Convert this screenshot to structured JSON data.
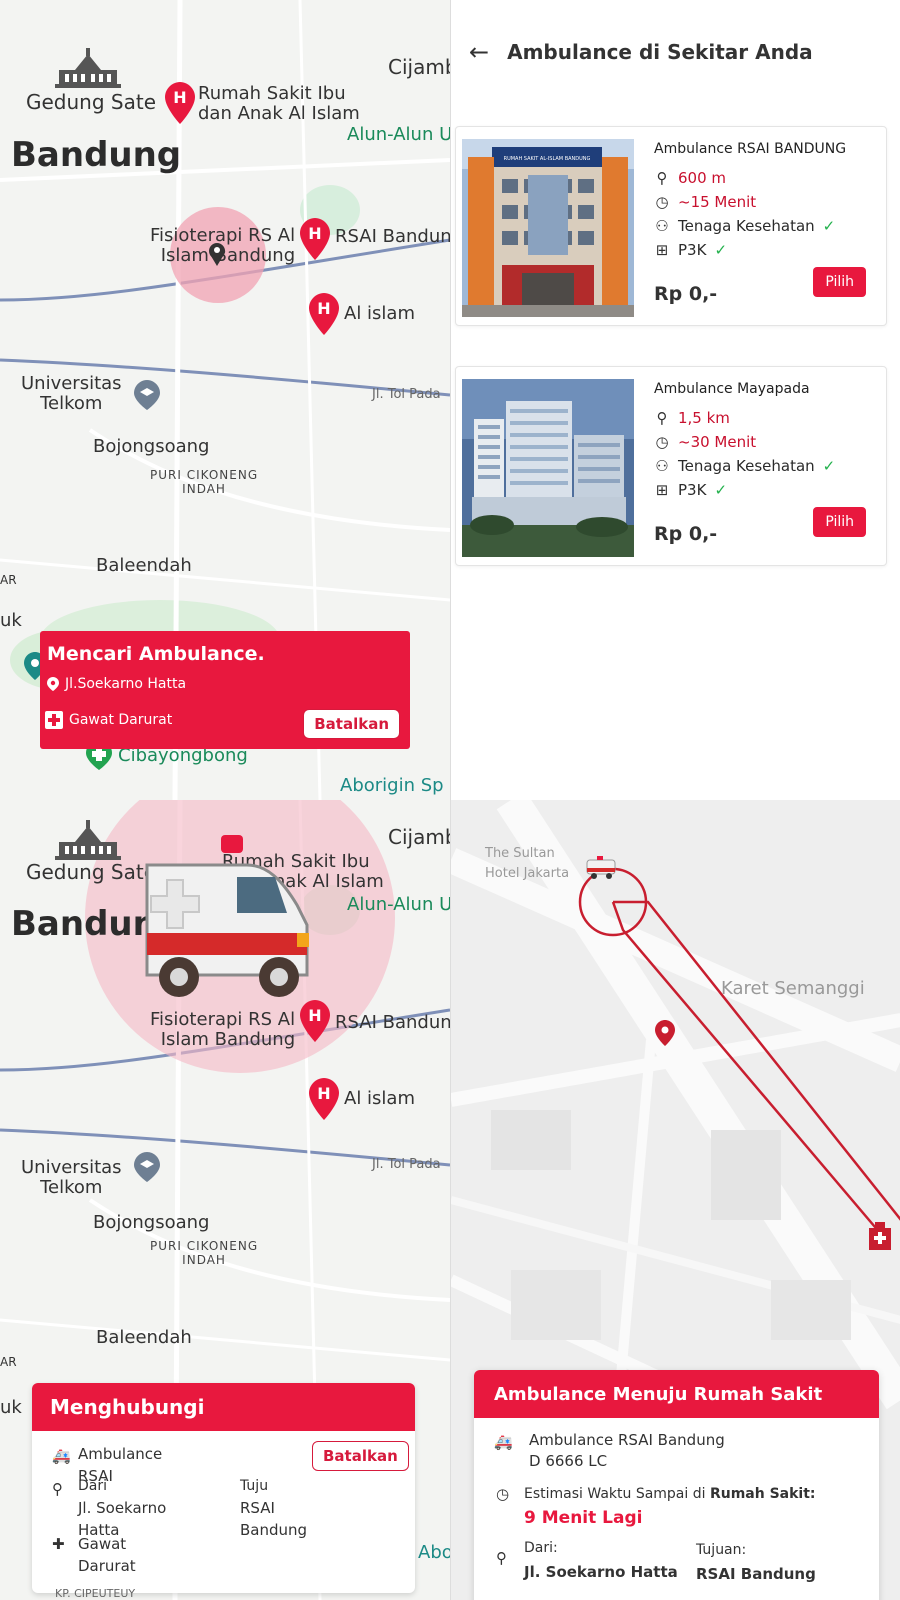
{
  "screen1": {
    "map_labels": {
      "gedung_sate": "Gedung Sate",
      "cijamb": "Cijamb",
      "rs_ibu_anak": "Rumah Sakit Ibu\ndan Anak Al Islam",
      "alun_alun": "Alun-Alun U",
      "bandung": "Bandung",
      "fisioterapi": "Fisioterapi RS Al\nIslam Bandung",
      "rsai_bandung": "RSAI Bandun",
      "al_islam": "Al islam",
      "universitas": "Universitas\nTelkom",
      "tol": "Jl. Tol Pada",
      "bojongsoang": "Bojongsoang",
      "puri": "PURI CIKONENG\nINDAH",
      "baleendah": "Baleendah",
      "ar": "AR",
      "uk": "uk",
      "cibayongbong": "Cibayongbong",
      "aborigin": "Aborigin Sp"
    },
    "card": {
      "title": "Mencari Ambulance.",
      "address": "Jl.Soekarno Hatta",
      "type": "Gawat Darurat",
      "cancel": "Batalkan"
    }
  },
  "screen2": {
    "title": "Ambulance di Sekitar Anda",
    "list": [
      {
        "name": "Ambulance RSAI BANDUNG",
        "distance": "600 m",
        "time": "~15 Menit",
        "staff": "Tenaga Kesehatan",
        "kit": "P3K",
        "price": "Rp 0,-",
        "button": "Pilih",
        "sign": "RUMAH SAKIT AL-ISLAM BANDUNG"
      },
      {
        "name": "Ambulance Mayapada",
        "distance": "1,5 km",
        "time": "~30 Menit",
        "staff": "Tenaga Kesehatan",
        "kit": "P3K",
        "price": "Rp 0,-",
        "button": "Pilih"
      }
    ]
  },
  "screen3": {
    "card": {
      "title": "Menghubungi",
      "ambulance": "Ambulance\nRSAI",
      "from_label": "Dari",
      "from_value": "Jl. Soekarno\nHatta",
      "to_label": "Tuju",
      "to_value": "RSAI\nBandung",
      "type": "Gawat\nDarurat",
      "cancel": "Batalkan",
      "peek": "KP. CIPEUTEUY"
    }
  },
  "screen4": {
    "map_labels": {
      "hotel": "The Sultan\nHotel Jakarta",
      "karet": "Karet Semanggi"
    },
    "card": {
      "title": "Ambulance Menuju Rumah Sakit",
      "ambulance": "Ambulance RSAI Bandung",
      "plate": "D 6666 LC",
      "eta_label_start": "Estimasi Waktu Sampai di ",
      "eta_label_bold": "Rumah Sakit:",
      "eta": "9 Menit Lagi",
      "from_label": "Dari:",
      "from_value": "Jl. Soekarno Hatta",
      "to_label": "Tujuan:",
      "to_value": "RSAI Bandung"
    }
  },
  "colors": {
    "accent": "#e8183e",
    "check": "#22b14c"
  }
}
